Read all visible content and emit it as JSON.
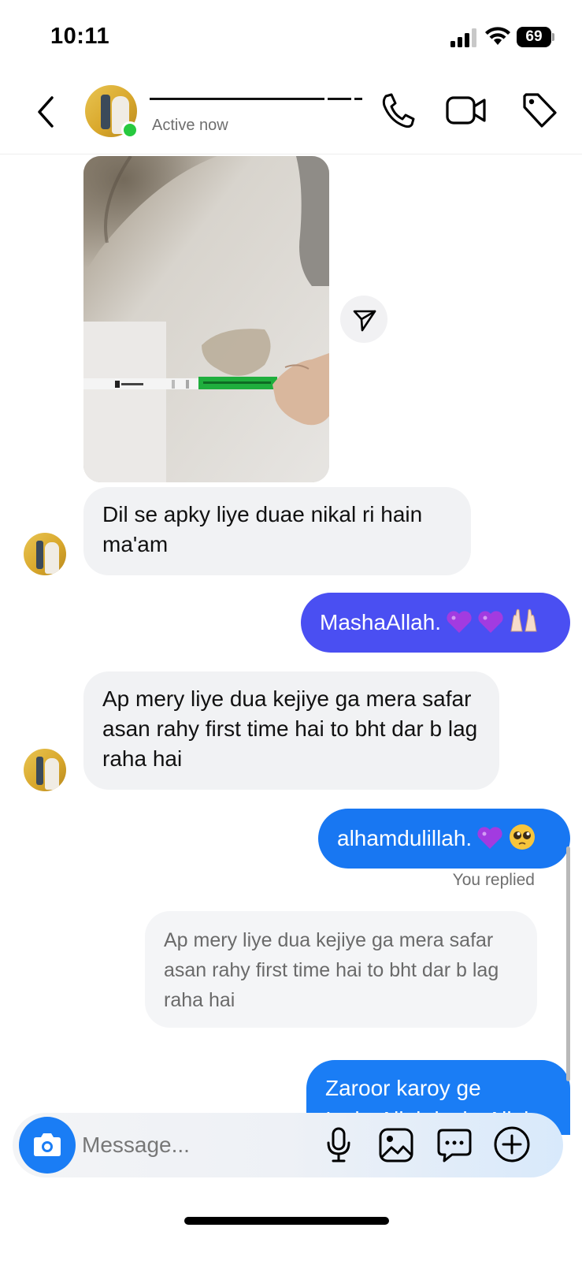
{
  "status_bar": {
    "time": "10:11",
    "battery": "69"
  },
  "header": {
    "active_status": "Active now",
    "online_color": "#27c93f"
  },
  "messages": [
    {
      "id": "m1",
      "direction": "incoming",
      "type": "photo"
    },
    {
      "id": "m2",
      "direction": "incoming",
      "text": "Dil se apky liye duae nikal ri hain ma'am"
    },
    {
      "id": "m3",
      "direction": "outgoing",
      "text": "MashaAllah.",
      "emoji": [
        "purple-heart",
        "purple-heart",
        "raising-hands"
      ]
    },
    {
      "id": "m4",
      "direction": "incoming",
      "text": "Ap mery liye dua kejiye ga mera safar asan rahy first time hai to bht dar b lag raha hai"
    },
    {
      "id": "m5",
      "direction": "outgoing",
      "text": "alhamdulillah.",
      "emoji": [
        "purple-heart",
        "pleading-face"
      ]
    },
    {
      "id": "m6",
      "direction": "outgoing",
      "replied_label": "You replied",
      "quote": "Ap mery liye dua kejiye ga mera safar asan rahy first time hai to bht dar b lag raha hai",
      "text": "Zaroor karoy ge InshaAllah inshaAllah"
    }
  ],
  "composer": {
    "placeholder": "Message..."
  },
  "colors": {
    "outgoing_purple": "#4a4ff2",
    "outgoing_blue": "#1877f2",
    "incoming_bg": "#f1f2f4",
    "accent": "#1a7df5"
  }
}
